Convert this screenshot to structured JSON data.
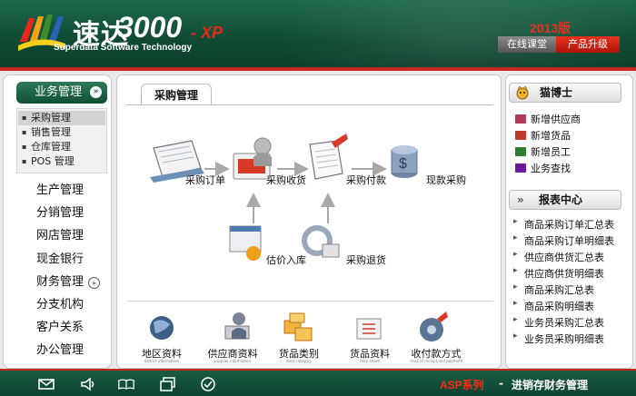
{
  "header": {
    "brand_cn": "速达",
    "brand_num": "3000",
    "brand_edition": "- XP",
    "brand_sub": "Superdata Software Technology",
    "version": "2013版",
    "online_btn": "在线课堂",
    "upgrade_btn": "产品升级"
  },
  "sidebar": {
    "active": "业务管理",
    "active_indicator": "»",
    "submenu": [
      "采购管理",
      "销售管理",
      "仓库管理",
      "POS 管理"
    ],
    "selected_submenu_index": 0,
    "items": [
      "生产管理",
      "分销管理",
      "网店管理",
      "现金银行",
      "财务管理",
      "分支机构",
      "客户关系",
      "办公管理"
    ],
    "finance_expand_indicator": "»"
  },
  "center": {
    "tab": "采购管理",
    "flow": {
      "order": "采购订单",
      "receive": "采购收货",
      "pay": "采购付款",
      "cash": "现款采购",
      "estimate": "估价入库",
      "return": "采购退货"
    },
    "bottom": [
      {
        "label": "地区资料",
        "en": "district information",
        "icon": "globe-icon"
      },
      {
        "label": "供应商资料",
        "en": "supplier information",
        "icon": "supplier-icon"
      },
      {
        "label": "货品类别",
        "en": "item category",
        "icon": "boxes-icon"
      },
      {
        "label": "货品资料",
        "en": "item sheet",
        "icon": "item-sheet-icon"
      },
      {
        "label": "收付款方式",
        "en": "class of receipt and payment",
        "icon": "payment-icon"
      }
    ]
  },
  "right": {
    "helper_title": "猫博士",
    "helper_links": [
      {
        "label": "新增供应商",
        "color": "#b23a5a"
      },
      {
        "label": "新增货品",
        "color": "#c0392b"
      },
      {
        "label": "新增员工",
        "color": "#2e7d32"
      },
      {
        "label": "业务查找",
        "color": "#6a1b9a"
      }
    ],
    "report_indicator": "»",
    "report_title": "报表中心",
    "reports": [
      "商品采购订单汇总表",
      "商品采购订单明细表",
      "供应商供货汇总表",
      "供应商供货明细表",
      "商品采购汇总表",
      "商品采购明细表",
      "业务员采购汇总表",
      "业务员采购明细表"
    ]
  },
  "footer": {
    "series": "ASP系列",
    "dash": "-",
    "title": "进销存财务管理",
    "icons": [
      "mail-icon",
      "speaker-icon",
      "book-icon",
      "window-icon",
      "check-icon"
    ]
  },
  "colors": {
    "brand_green": "#0f4f36",
    "accent_red": "#c8261a",
    "asp_red": "#ff2a18"
  }
}
